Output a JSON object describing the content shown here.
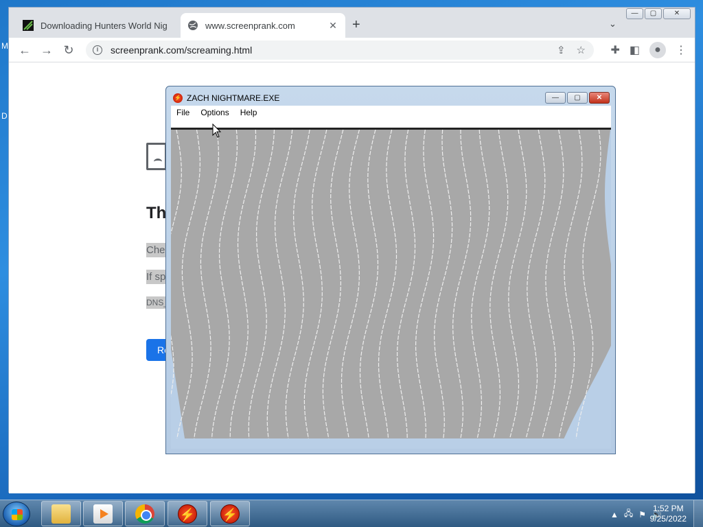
{
  "desktop": {
    "edge_glyphs": [
      "M",
      "D"
    ]
  },
  "browser": {
    "tabs": [
      {
        "title": "Downloading Hunters World Nig",
        "favicon": "download-favicon",
        "active": false
      },
      {
        "title": "www.screenprank.com",
        "favicon": "globe-icon",
        "active": true
      }
    ],
    "url": "screenprank.com/screaming.html",
    "page": {
      "heading_fragment": "Th",
      "line1_fragment": "Chec",
      "line2_fragment": "If sp",
      "line3_fragment": "DNS_",
      "button_fragment": "Re"
    }
  },
  "popup": {
    "title": "ZACH NIGHTMARE.EXE",
    "menu": [
      "File",
      "Options",
      "Help"
    ]
  },
  "taskbar": {
    "time": "1:52 PM",
    "date": "9/25/2022",
    "items": [
      "explorer",
      "media-player",
      "chrome",
      "zach-nightmare",
      "zach-nightmare"
    ]
  }
}
